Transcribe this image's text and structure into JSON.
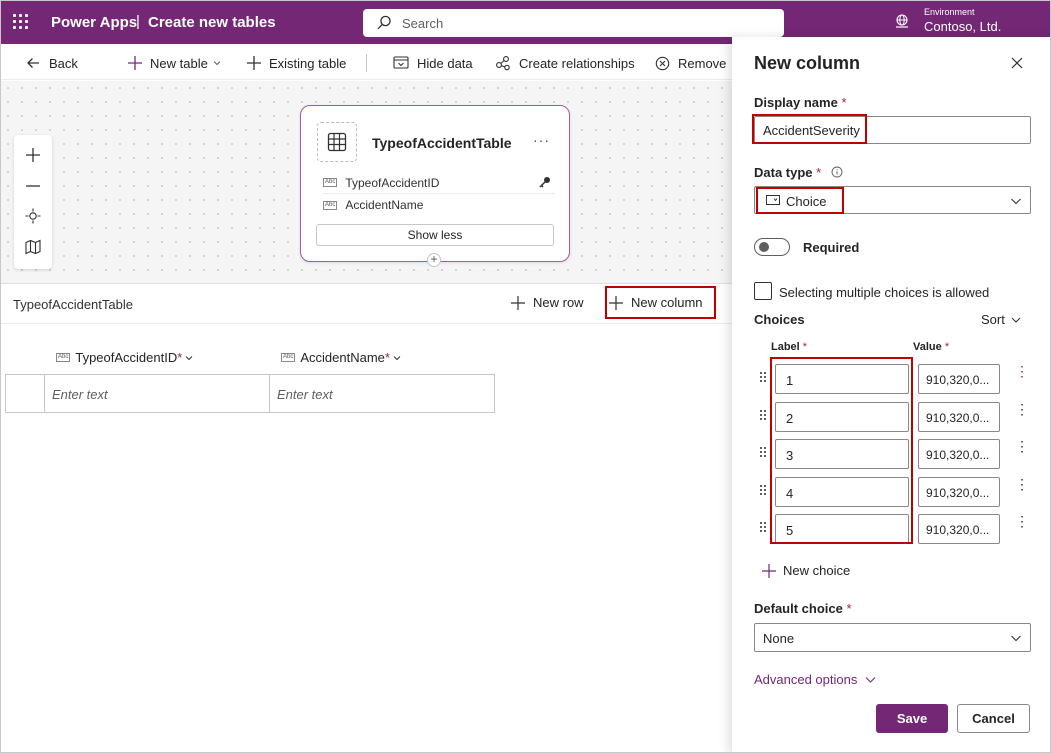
{
  "header": {
    "app_name": "Power Apps",
    "separator": "|",
    "page_title": "Create new tables",
    "search_placeholder": "Search",
    "environment_label": "Environment",
    "environment_name": "Contoso, Ltd.",
    "brand_color": "#742774"
  },
  "commandbar": {
    "back": "Back",
    "new_table": "New table",
    "existing_table": "Existing table",
    "hide_data": "Hide data",
    "create_relationships": "Create relationships",
    "remove": "Remove"
  },
  "table_card": {
    "title": "TypeofAccidentTable",
    "more": "···",
    "columns": [
      "TypeofAccidentID",
      "AccidentName"
    ],
    "type_badge": "Abc",
    "show_less": "Show less"
  },
  "gridbar": {
    "table_name": "TypeofAccidentTable",
    "new_row": "New row",
    "new_column": "New column"
  },
  "grid": {
    "columns": [
      {
        "name": "TypeofAccidentID",
        "required": "*"
      },
      {
        "name": "AccidentName",
        "required": "*"
      }
    ],
    "placeholders": [
      "Enter text",
      "Enter text"
    ]
  },
  "panel": {
    "title": "New column",
    "display_name_label": "Display name",
    "required_mark": "*",
    "display_name_value": "AccidentSeverity",
    "data_type_label": "Data type",
    "data_type_value": "Choice",
    "required_toggle_label": "Required",
    "required_on": false,
    "multi_choice_label": "Selecting multiple choices is allowed",
    "multi_choice_checked": false,
    "choices_title": "Choices",
    "sort_label": "Sort",
    "label_header": "Label",
    "value_header": "Value",
    "choices": [
      {
        "label": "1",
        "value": "910,320,0..."
      },
      {
        "label": "2",
        "value": "910,320,0..."
      },
      {
        "label": "3",
        "value": "910,320,0..."
      },
      {
        "label": "4",
        "value": "910,320,0..."
      },
      {
        "label": "5",
        "value": "910,320,0..."
      }
    ],
    "new_choice": "New choice",
    "default_choice_label": "Default choice",
    "default_choice_value": "None",
    "advanced_options": "Advanced options",
    "save": "Save",
    "cancel": "Cancel"
  }
}
